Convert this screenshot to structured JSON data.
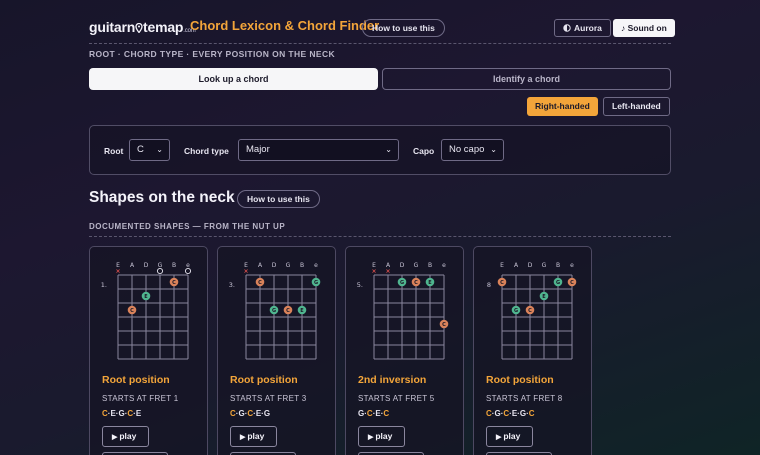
{
  "header": {
    "logo_prefix": "guitarn",
    "logo_suffix": "temap",
    "logo_dot": ".com",
    "title": "Chord Lexicon & Chord Finder",
    "how_label": "How to use this",
    "theme_label": "Aurora",
    "sound_label": "Sound on"
  },
  "subtitle": "ROOT · CHORD TYPE · EVERY POSITION ON THE NECK",
  "tabs": {
    "lookup": "Look up a chord",
    "identify": "Identify a chord"
  },
  "handed": {
    "right": "Right-handed",
    "left": "Left-handed"
  },
  "controls": {
    "root_label": "Root",
    "root_value": "C",
    "type_label": "Chord type",
    "type_value": "Major",
    "capo_label": "Capo",
    "capo_value": "No capo"
  },
  "shapes": {
    "heading": "Shapes on the neck",
    "how_label": "How to use this",
    "section_label": "DOCUMENTED SHAPES — FROM THE NUT UP"
  },
  "string_labels": [
    "E",
    "A",
    "D",
    "G",
    "B",
    "e"
  ],
  "play_label": "play",
  "cards": [
    {
      "name": "Root position",
      "fret_text": "STARTS AT FRET 1",
      "fret_marker": "1.",
      "notes": [
        "C",
        "E",
        "G",
        "C",
        "E"
      ],
      "root_notes": [
        0,
        3
      ],
      "strings": [
        "x",
        "C",
        "E",
        "o",
        "C",
        "o"
      ],
      "dots": [
        {
          "s": 1,
          "f": 3,
          "n": "C",
          "root": true
        },
        {
          "s": 2,
          "f": 2,
          "n": "E",
          "root": false
        },
        {
          "s": 4,
          "f": 1,
          "n": "C",
          "root": true
        }
      ],
      "open": [
        3,
        5
      ],
      "muted": [
        0
      ]
    },
    {
      "name": "Root position",
      "fret_text": "STARTS AT FRET 3",
      "fret_marker": "3.",
      "notes": [
        "C",
        "G",
        "C",
        "E",
        "G"
      ],
      "root_notes": [
        0,
        2
      ],
      "dots": [
        {
          "s": 1,
          "f": 1,
          "n": "C",
          "root": true
        },
        {
          "s": 2,
          "f": 3,
          "n": "G",
          "root": false
        },
        {
          "s": 3,
          "f": 3,
          "n": "C",
          "root": true
        },
        {
          "s": 4,
          "f": 3,
          "n": "E",
          "root": false
        },
        {
          "s": 5,
          "f": 1,
          "n": "G",
          "root": false
        }
      ],
      "open": [],
      "muted": [
        0
      ]
    },
    {
      "name": "2nd inversion",
      "fret_text": "STARTS AT FRET 5",
      "fret_marker": "5.",
      "notes": [
        "G",
        "C",
        "E",
        "C"
      ],
      "root_notes": [
        1,
        3
      ],
      "dots": [
        {
          "s": 2,
          "f": 1,
          "n": "G",
          "root": false
        },
        {
          "s": 3,
          "f": 1,
          "n": "C",
          "root": true
        },
        {
          "s": 4,
          "f": 1,
          "n": "E",
          "root": false
        },
        {
          "s": 5,
          "f": 4,
          "n": "C",
          "root": true
        }
      ],
      "open": [],
      "muted": [
        0,
        1
      ]
    },
    {
      "name": "Root position",
      "fret_text": "STARTS AT FRET 8",
      "fret_marker": "8",
      "notes": [
        "C",
        "G",
        "C",
        "E",
        "G",
        "C"
      ],
      "root_notes": [
        0,
        2,
        5
      ],
      "dots": [
        {
          "s": 0,
          "f": 1,
          "n": "C",
          "root": true
        },
        {
          "s": 1,
          "f": 3,
          "n": "G",
          "root": false
        },
        {
          "s": 2,
          "f": 3,
          "n": "C",
          "root": true
        },
        {
          "s": 3,
          "f": 2,
          "n": "E",
          "root": false
        },
        {
          "s": 4,
          "f": 1,
          "n": "G",
          "root": false
        },
        {
          "s": 5,
          "f": 1,
          "n": "C",
          "root": true
        }
      ],
      "open": [],
      "muted": []
    }
  ],
  "colors": {
    "accent": "#f3a53a",
    "root_dot": "#d9825a",
    "other_dot": "#4fb58f",
    "mute": "#e0504d"
  }
}
